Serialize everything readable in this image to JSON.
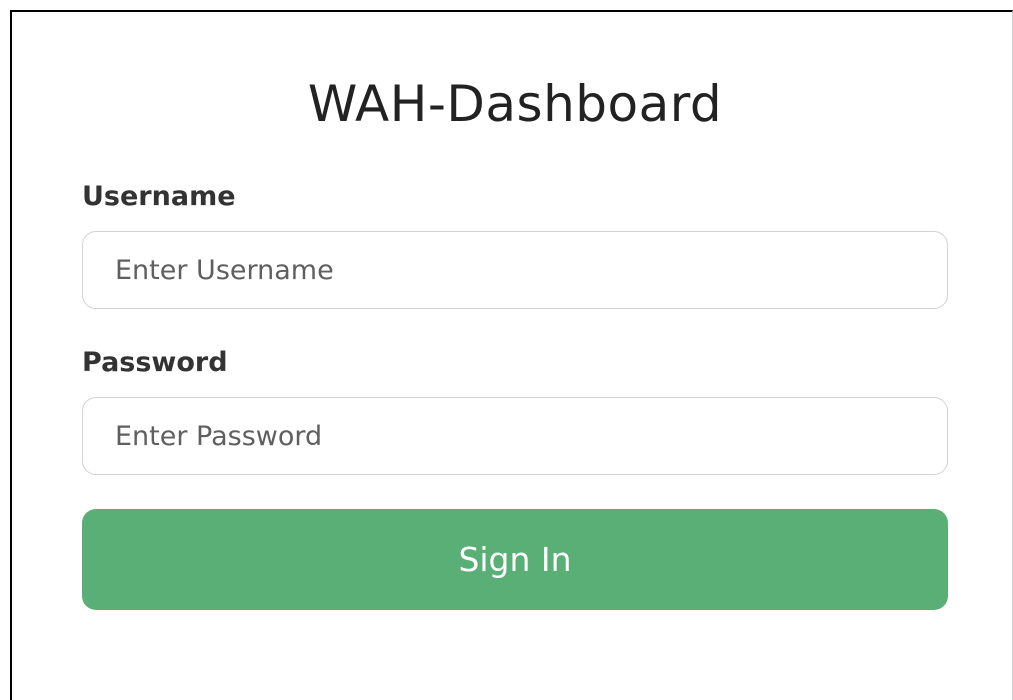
{
  "app": {
    "title": "WAH-Dashboard"
  },
  "form": {
    "username": {
      "label": "Username",
      "placeholder": "Enter Username",
      "value": ""
    },
    "password": {
      "label": "Password",
      "placeholder": "Enter Password",
      "value": ""
    },
    "submit_label": "Sign In"
  },
  "colors": {
    "primary_button": "#5aaf76",
    "title_text": "#222222",
    "label_text": "#333333",
    "input_border": "#d2d2d2"
  }
}
